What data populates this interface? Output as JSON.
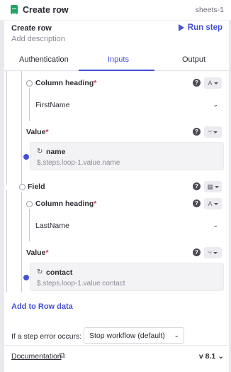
{
  "topbar": {
    "app_icon": "google-sheets-icon",
    "title": "Create row",
    "chevron": "⌄",
    "step_id": "sheets-1"
  },
  "header": {
    "title": "Create row",
    "description_placeholder": "Add description",
    "run_step_label": "Run step"
  },
  "tabs": [
    {
      "label": "Authentication",
      "active": false
    },
    {
      "label": "Inputs",
      "active": true
    },
    {
      "label": "Output",
      "active": false
    }
  ],
  "fields": [
    {
      "column_heading_label": "Column heading",
      "column_value": "FirstName",
      "value_label": "Value",
      "value_name": "name",
      "value_path": "$.steps.loop-1.value.name"
    },
    {
      "field_label": "Field",
      "column_heading_label": "Column heading",
      "column_value": "LastName",
      "value_label": "Value",
      "value_name": "contact",
      "value_path": "$.steps.loop-1.value.contact"
    }
  ],
  "required_mark": "*",
  "help_glyph": "?",
  "type_glyphs": {
    "text": "A",
    "branch": "⑂",
    "table": "▦"
  },
  "add_link": "Add to Row data",
  "error_handling": {
    "label": "If a step error occurs:",
    "selected": "Stop workflow (default)"
  },
  "footer": {
    "documentation": "Documentation",
    "version": "v 8.1"
  },
  "colors": {
    "accent": "#4450d6",
    "required": "#d6334a",
    "sheets_green": "#1fa463"
  }
}
